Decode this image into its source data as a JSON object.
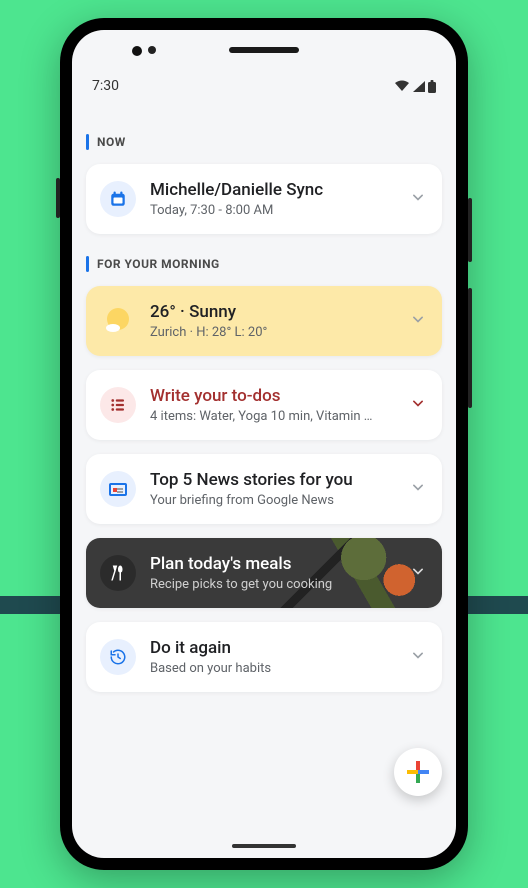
{
  "status": {
    "time": "7:30"
  },
  "sections": {
    "now": {
      "label": "NOW"
    },
    "morning": {
      "label": "FOR YOUR MORNING"
    }
  },
  "cards": {
    "event": {
      "title": "Michelle/Danielle Sync",
      "subtitle": "Today, 7:30 - 8:00 AM"
    },
    "weather": {
      "title": "26° · Sunny",
      "subtitle": "Zurich · H: 28°  L: 20°"
    },
    "todos": {
      "title": "Write your to-dos",
      "subtitle": "4 items: Water, Yoga 10 min, Vitamin …"
    },
    "news": {
      "title": "Top 5 News stories for you",
      "subtitle": "Your briefing from Google News"
    },
    "meals": {
      "title": "Plan today's meals",
      "subtitle": "Recipe picks to get you cooking"
    },
    "again": {
      "title": "Do it again",
      "subtitle": "Based on your habits"
    }
  }
}
